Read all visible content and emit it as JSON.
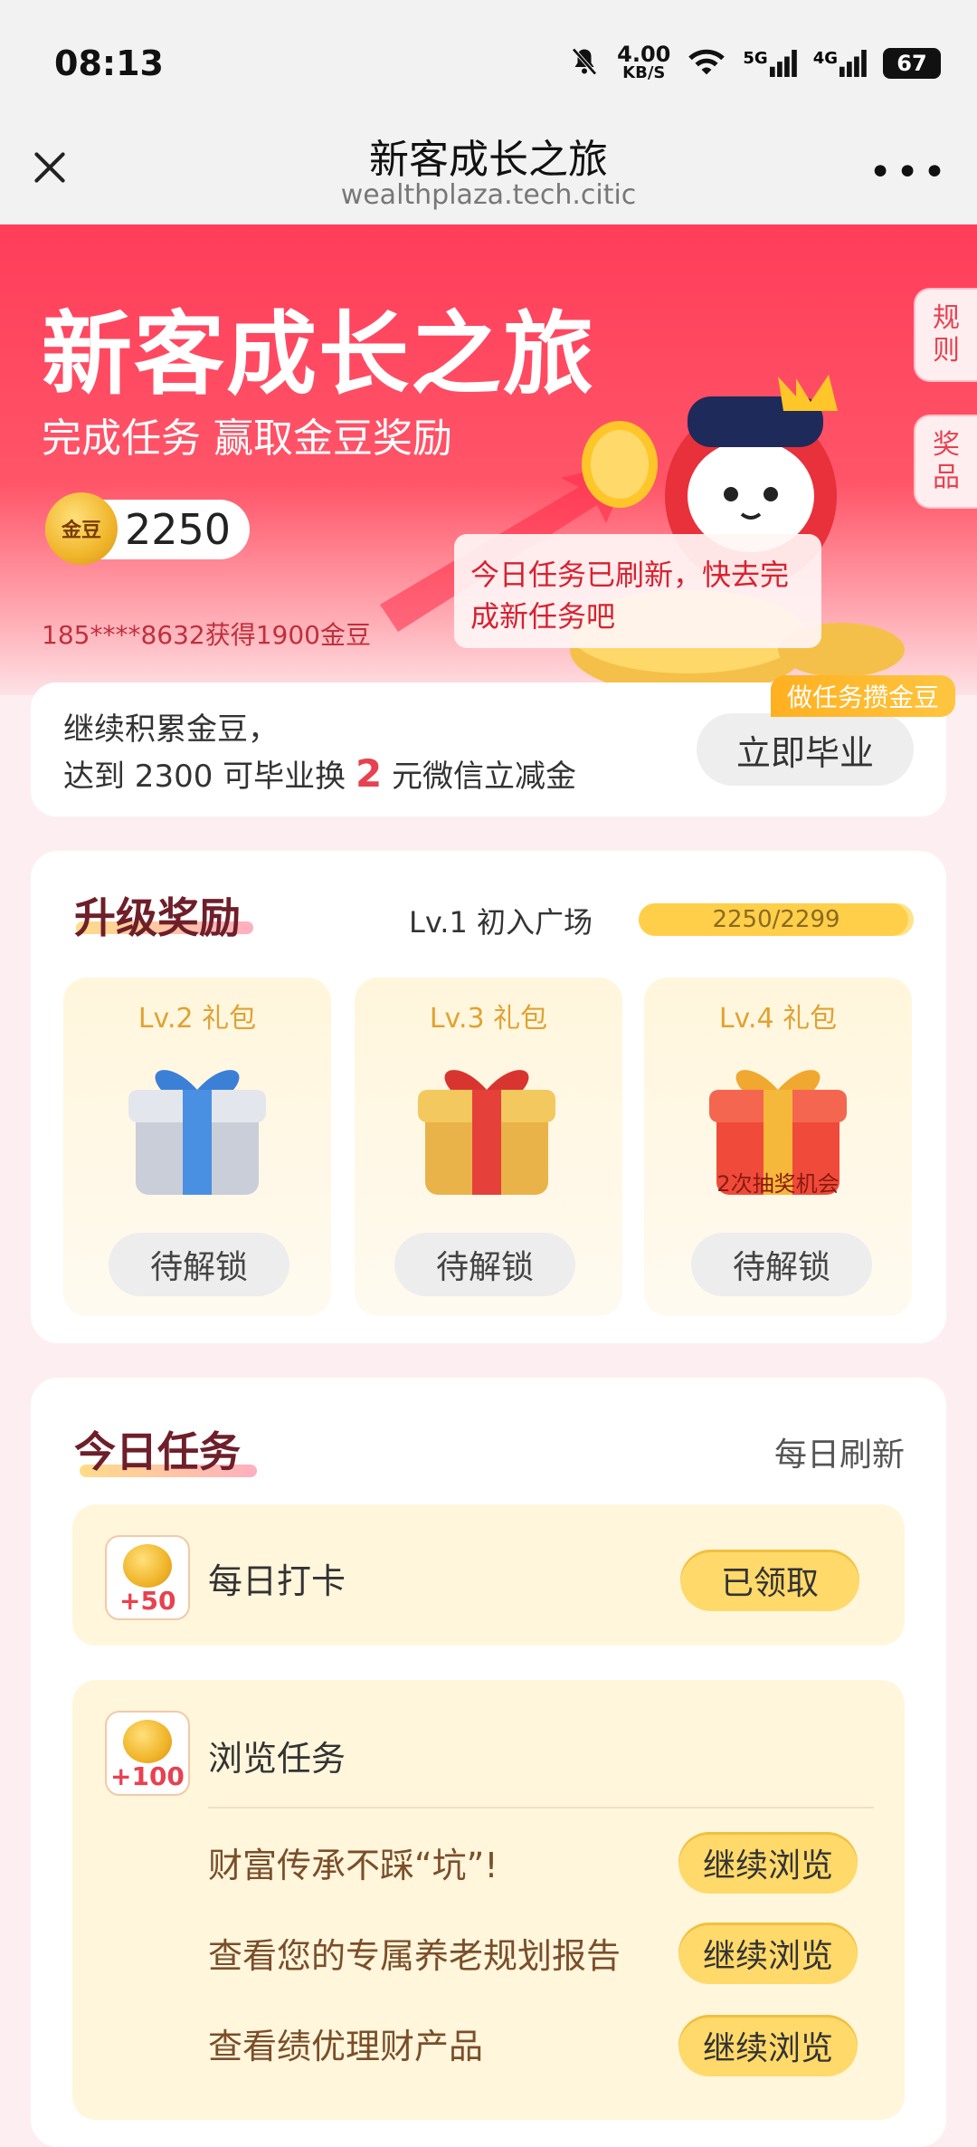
{
  "status_bar": {
    "time": "08:13",
    "net_speed_value": "4.00",
    "net_speed_unit": "KB/S",
    "signal_a": "5G",
    "signal_b": "4G",
    "battery": "67"
  },
  "titlebar": {
    "title": "新客成长之旅",
    "url": "wealthplaza.tech.citic"
  },
  "hero": {
    "title": "新客成长之旅",
    "subtitle": "完成任务 赢取金豆奖励",
    "coin_label": "金豆",
    "coin_balance": "2250",
    "winner_text": "185****8632获得1900金豆",
    "rules_tab": "规则",
    "prize_tab": "奖品",
    "toast": "今日任务已刷新，快去完成新任务吧"
  },
  "graduation": {
    "line1": "继续积累金豆，",
    "line2_prefix": "达到 2300 可毕业换 ",
    "line2_amount": "2",
    "line2_suffix": " 元微信立减金",
    "button": "立即毕业",
    "tag": "做任务攒金豆"
  },
  "upgrade": {
    "title": "升级奖励",
    "level": "Lv.1 初入广场",
    "progress_text": "2250/2299",
    "progress": 0.979,
    "gifts": [
      {
        "name": "Lv.2 礼包",
        "button": "待解锁",
        "color": "#4a90e2"
      },
      {
        "name": "Lv.3 礼包",
        "button": "待解锁",
        "color": "#e5403a"
      },
      {
        "name": "Lv.4 礼包",
        "button": "待解锁",
        "color": "#f04a3a",
        "badge": "2次抽奖机会"
      }
    ]
  },
  "tasks": {
    "title": "今日任务",
    "refresh": "每日刷新",
    "checkin": {
      "reward": "+50",
      "name": "每日打卡",
      "button": "已领取"
    },
    "browse": {
      "reward": "+100",
      "name": "浏览任务",
      "items": [
        {
          "label": "财富传承不踩“坑”!",
          "button": "继续浏览"
        },
        {
          "label": "查看您的专属养老规划报告",
          "button": "继续浏览"
        },
        {
          "label": "查看绩优理财产品",
          "button": "继续浏览"
        }
      ]
    }
  }
}
